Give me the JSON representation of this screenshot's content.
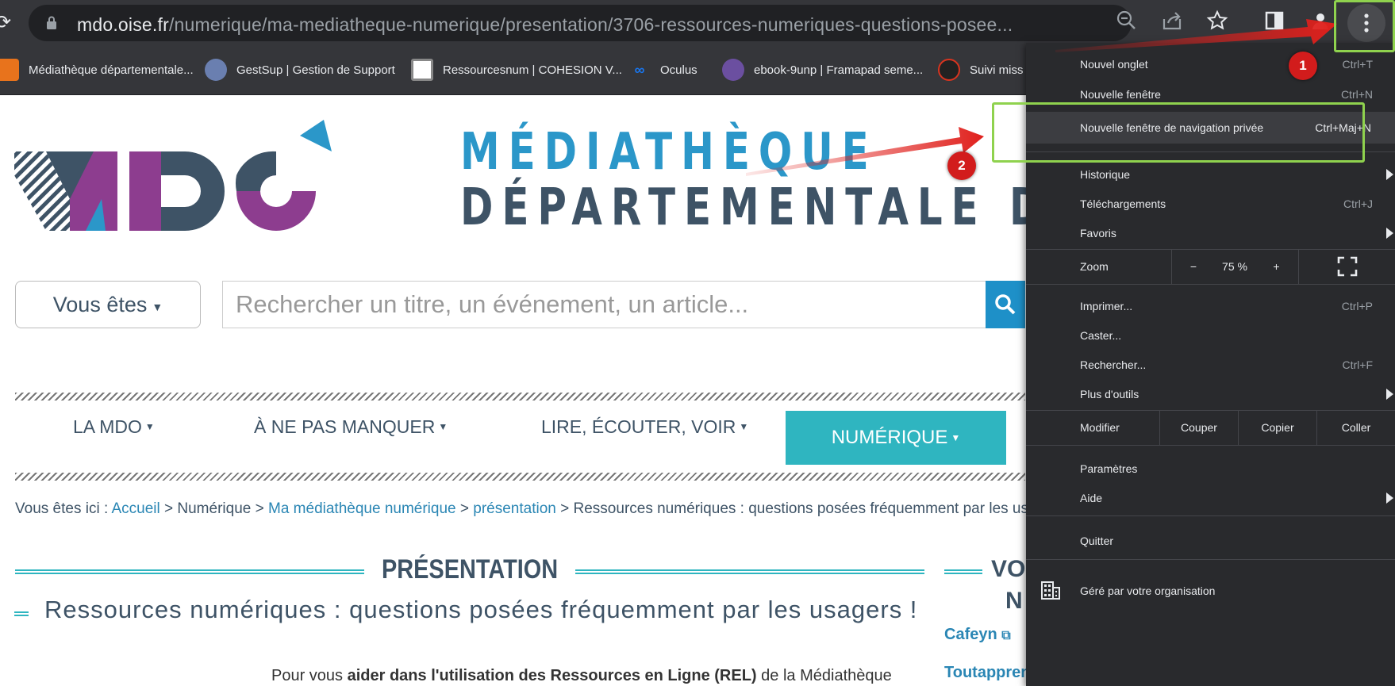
{
  "browser": {
    "url_host": "mdo.oise.fr",
    "url_path": "/numerique/ma-mediatheque-numerique/presentation/3706-ressources-numeriques-questions-posee...",
    "bookmarks": [
      {
        "label": "Médiathèque départementale...",
        "icon": "mdo-favicon",
        "color": "#e8731c"
      },
      {
        "label": "GestSup | Gestion de Support",
        "icon": "gestsup-favicon",
        "color": "#6a7fb0"
      },
      {
        "label": "Ressourcesnum | COHESION V...",
        "icon": "ressourcesnum-favicon",
        "color": "#cccccc"
      },
      {
        "label": "Oculus",
        "icon": "meta-favicon",
        "color": "#1877f2"
      },
      {
        "label": "ebook-9unp | Framapad seme...",
        "icon": "framapad-favicon",
        "color": "#6b4fa0"
      },
      {
        "label": "Suivi miss",
        "icon": "suivi-favicon",
        "color": "#d9341f"
      }
    ]
  },
  "site": {
    "banner_line1": "MÉDIATHÈQUE",
    "banner_line2": "DÉPARTEMENTALE DE",
    "vous_etes": "Vous êtes",
    "search_placeholder": "Rechercher un titre, un événement, un article...",
    "nav": [
      {
        "label": "LA MDO"
      },
      {
        "label": "À NE PAS MANQUER"
      },
      {
        "label": "LIRE, ÉCOUTER, VOIR"
      },
      {
        "label": "NUMÉRIQUE"
      }
    ],
    "breadcrumb": {
      "prefix": "Vous êtes ici :",
      "accueil": "Accueil",
      "numerique": "Numérique",
      "ma_mediatheque": "Ma médiathèque numérique",
      "presentation": "présentation",
      "current": "Ressources numériques : questions posées fréquemment par les usagers !",
      "sep": ">"
    },
    "section_title": "PRÉSENTATION",
    "article_title": "Ressources numériques : questions posées fréquemment par les usagers !",
    "para_start": "Pour vous ",
    "para_bold": "aider dans l'utilisation des Ressources en Ligne (REL)",
    "para_end": " de la Médiathèque",
    "side_title_1": "VOS",
    "side_title_2": "N",
    "side_links": [
      "Cafeyn",
      "Toutapprendre.com"
    ]
  },
  "menu": {
    "new_tab": {
      "label": "Nouvel onglet",
      "shortcut": "Ctrl+T"
    },
    "new_window": {
      "label": "Nouvelle fenêtre",
      "shortcut": "Ctrl+N"
    },
    "incognito": {
      "label": "Nouvelle fenêtre de navigation privée",
      "shortcut": "Ctrl+Maj+N"
    },
    "history": {
      "label": "Historique"
    },
    "downloads": {
      "label": "Téléchargements",
      "shortcut": "Ctrl+J"
    },
    "bookmarks": {
      "label": "Favoris"
    },
    "zoom": {
      "label": "Zoom",
      "minus": "−",
      "value": "75 %",
      "plus": "+"
    },
    "print": {
      "label": "Imprimer...",
      "shortcut": "Ctrl+P"
    },
    "cast": {
      "label": "Caster..."
    },
    "find": {
      "label": "Rechercher...",
      "shortcut": "Ctrl+F"
    },
    "more_tools": {
      "label": "Plus d'outils"
    },
    "edit": {
      "label": "Modifier",
      "cut": "Couper",
      "copy": "Copier",
      "paste": "Coller"
    },
    "settings": {
      "label": "Paramètres"
    },
    "help": {
      "label": "Aide"
    },
    "quit": {
      "label": "Quitter"
    },
    "managed": {
      "label": "Géré par votre organisation"
    }
  },
  "annotations": {
    "step1": "1",
    "step2": "2",
    "arrow_color": "#e0201c",
    "box_color": "#8fd24e"
  }
}
